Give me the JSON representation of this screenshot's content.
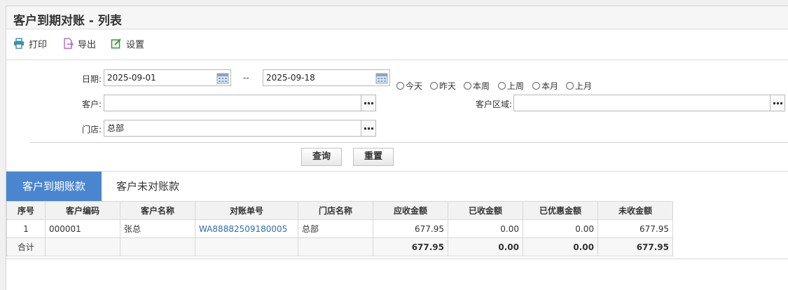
{
  "header": {
    "title": "客户到期对账 - 列表"
  },
  "toolbar": {
    "print": {
      "label": "打印",
      "icon": "printer-icon"
    },
    "export": {
      "label": "导出",
      "icon": "export-icon"
    },
    "settings": {
      "label": "设置",
      "icon": "edit-settings-icon"
    }
  },
  "filters": {
    "date_label": "日期:",
    "date_from": "2025-09-01",
    "date_sep": "--",
    "date_to": "2025-09-18",
    "quick_dates": [
      "今天",
      "昨天",
      "本周",
      "上周",
      "本月",
      "上月"
    ],
    "customer_label": "客户:",
    "customer_value": "",
    "region_label": "客户区域:",
    "region_value": "",
    "store_label": "门店:",
    "store_value": "总部"
  },
  "actions": {
    "query": "查询",
    "reset": "重置"
  },
  "tabs": [
    {
      "label": "客户到期账款",
      "active": true
    },
    {
      "label": "客户未对账款",
      "active": false
    }
  ],
  "table": {
    "headers": [
      "序号",
      "客户编码",
      "客户名称",
      "对账单号",
      "门店名称",
      "应收金额",
      "已收金额",
      "已优惠金额",
      "未收金额"
    ],
    "rows": [
      [
        "1",
        "000001",
        "张总",
        "WA88882509180005",
        "总部",
        "677.95",
        "0.00",
        "0.00",
        "677.95"
      ]
    ],
    "total": [
      "合计",
      "",
      "",
      "",
      "",
      "677.95",
      "0.00",
      "0.00",
      "677.95"
    ]
  },
  "colors": {
    "accent": "#4a86cf",
    "link": "#2a6fb6",
    "icon_green": "#3a9b3a",
    "icon_purple": "#b86bc7",
    "icon_teal": "#3c8fae"
  }
}
